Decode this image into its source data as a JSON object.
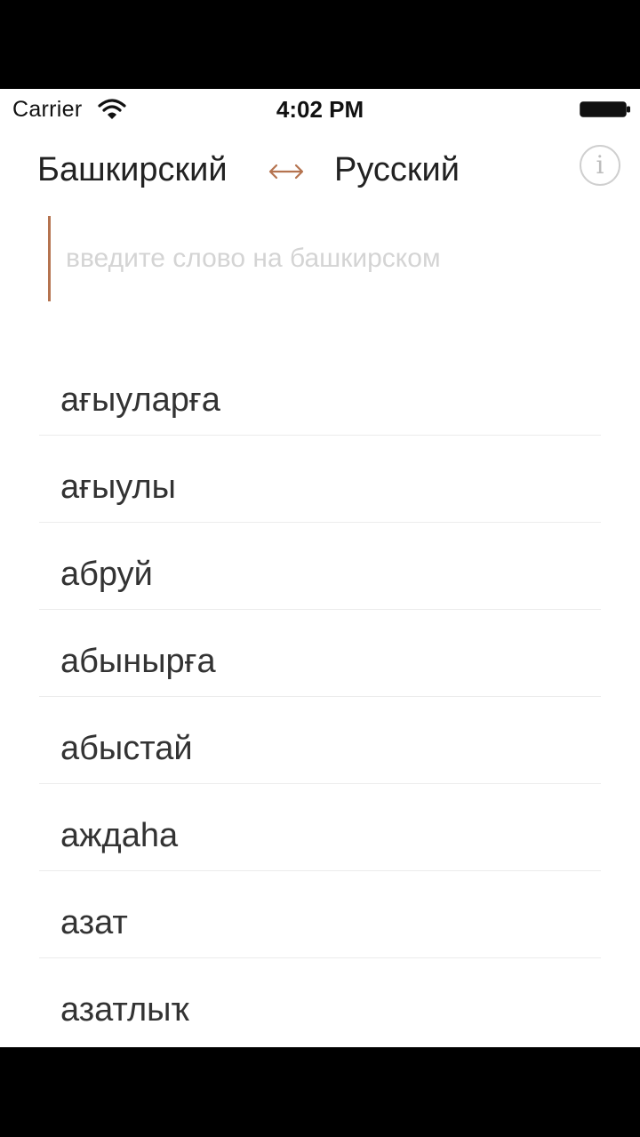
{
  "status_bar": {
    "carrier": "Carrier",
    "time": "4:02 PM"
  },
  "header": {
    "lang_from": "Башкирский",
    "lang_to": "Русский",
    "swap_icon": "left-right-arrow-icon",
    "info_icon": "info-icon",
    "info_label": "i"
  },
  "search": {
    "placeholder": "введите слово на башкирском",
    "value": ""
  },
  "words": [
    "ағыуларға",
    "ағыулы",
    "абруй",
    "абынырға",
    "абыстай",
    "аждаһа",
    "азат",
    "азатлыҡ"
  ],
  "colors": {
    "accent": "#b5734f",
    "placeholder": "#d4d4d4",
    "text": "#333333"
  }
}
